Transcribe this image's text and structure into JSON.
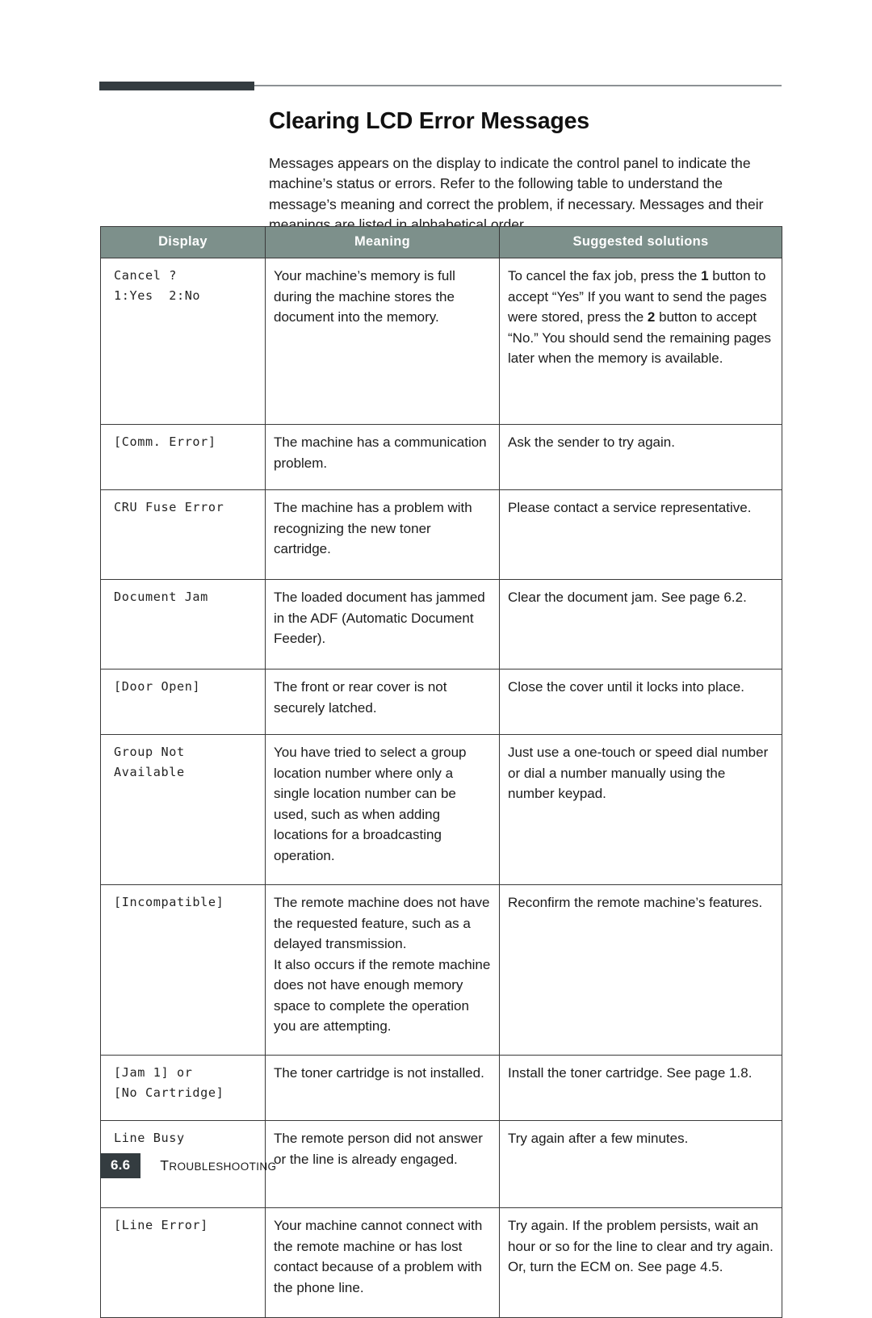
{
  "document": {
    "title": "Clearing LCD Error Messages",
    "intro": "Messages appears on the display to indicate the control panel to indicate the machine’s status or errors. Refer to the following table to understand the message’s meaning and correct the problem, if necessary. Messages and their meanings are listed in alphabetical order."
  },
  "colors": {
    "header_bar": "#343c40",
    "table_header": "#7d908b",
    "table_border": "#3a3a3a",
    "text": "#1b1b1b"
  },
  "table": {
    "columns": [
      "Display",
      "Meaning",
      "Suggested solutions"
    ],
    "rows": [
      {
        "display": "Cancel ?\n1:Yes  2:No",
        "meaning": "Your machine’s memory is full during the machine stores the document into the memory.",
        "solution_parts": [
          {
            "t": "To cancel the fax job, press the ",
            "b": false
          },
          {
            "t": "1",
            "b": true
          },
          {
            "t": " button to accept “Yes”\nIf you want to send the pages were stored, press the ",
            "b": false
          },
          {
            "t": "2",
            "b": true
          },
          {
            "t": " button to accept “No.” You should send the remaining pages later when the memory is available.",
            "b": false
          }
        ]
      },
      {
        "display": "[Comm. Error]",
        "meaning": "The machine has a communication problem.",
        "solution": "Ask the sender to try again."
      },
      {
        "display": "CRU Fuse Error",
        "meaning": "The machine has a problem with recognizing the new toner cartridge.",
        "solution": "Please contact a service representative."
      },
      {
        "display": "Document Jam",
        "meaning": "The loaded document has jammed in the ADF (Automatic Document Feeder).",
        "solution": "Clear the document jam. See page 6.2."
      },
      {
        "display": "[Door Open]",
        "meaning": "The front or rear cover is not securely latched.",
        "solution": "Close the cover until it locks into place."
      },
      {
        "display": "Group Not\nAvailable",
        "meaning": "You have tried to select a group location number where only a single location number can be used, such as when adding locations for a broadcasting operation.",
        "solution": "Just use a one-touch or speed dial number or dial a number manually using the number keypad."
      },
      {
        "display": "[Incompatible]",
        "meaning": "The remote machine does not have the requested feature, such as a delayed transmission.\nIt also occurs if the remote machine does not have enough memory space to complete the operation you are attempting.",
        "solution": "Reconfirm the remote machine’s features."
      },
      {
        "display": "[Jam 1] or\n[No Cartridge]",
        "meaning": "The toner cartridge is not installed.",
        "solution": "Install the toner cartridge. See page 1.8."
      },
      {
        "display": "Line Busy",
        "meaning": "The remote person did not answer or the line is already engaged.",
        "solution": "Try again after a few minutes."
      },
      {
        "display": "[Line Error]",
        "meaning": "Your machine cannot connect with the remote machine or has lost contact because of a problem with the phone line.",
        "solution": "Try again. If the problem persists, wait an hour or so for the line to clear and try again.\nOr, turn the ECM on. See page 4.5."
      }
    ]
  },
  "footer": {
    "page_number": "6.6",
    "chapter_first_letter": "T",
    "chapter_rest": "ROUBLESHOOTING"
  }
}
